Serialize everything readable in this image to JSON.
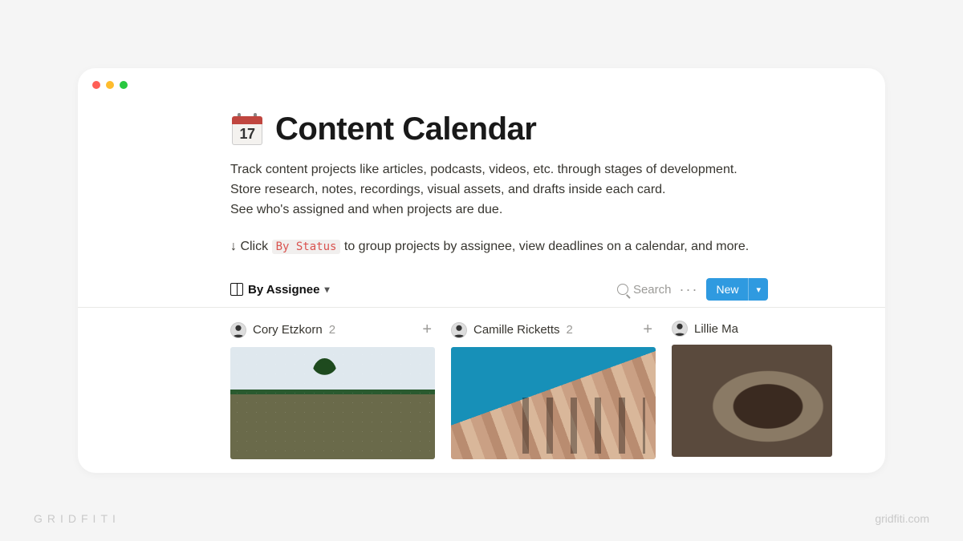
{
  "page": {
    "icon_day": "17",
    "title": "Content Calendar",
    "desc_line1": "Track content projects like articles, podcasts, videos, etc. through stages of development.",
    "desc_line2": "Store research, notes, recordings, visual assets, and drafts inside each card.",
    "desc_line3": "See who's assigned and when projects are due.",
    "hint_prefix": "↓ Click ",
    "hint_chip": "By Status",
    "hint_suffix": " to group projects by assignee, view deadlines on a calendar, and more."
  },
  "toolbar": {
    "view_label": "By Assignee",
    "search_label": "Search",
    "new_label": "New"
  },
  "board": {
    "columns": [
      {
        "name": "Cory Etzkorn",
        "count": "2",
        "image": "festival"
      },
      {
        "name": "Camille Ricketts",
        "count": "2",
        "image": "building"
      },
      {
        "name": "Lillie Ma",
        "count": "",
        "image": "coffee"
      }
    ]
  },
  "footer": {
    "brand": "GRIDFITI",
    "url": "gridfiti.com"
  }
}
